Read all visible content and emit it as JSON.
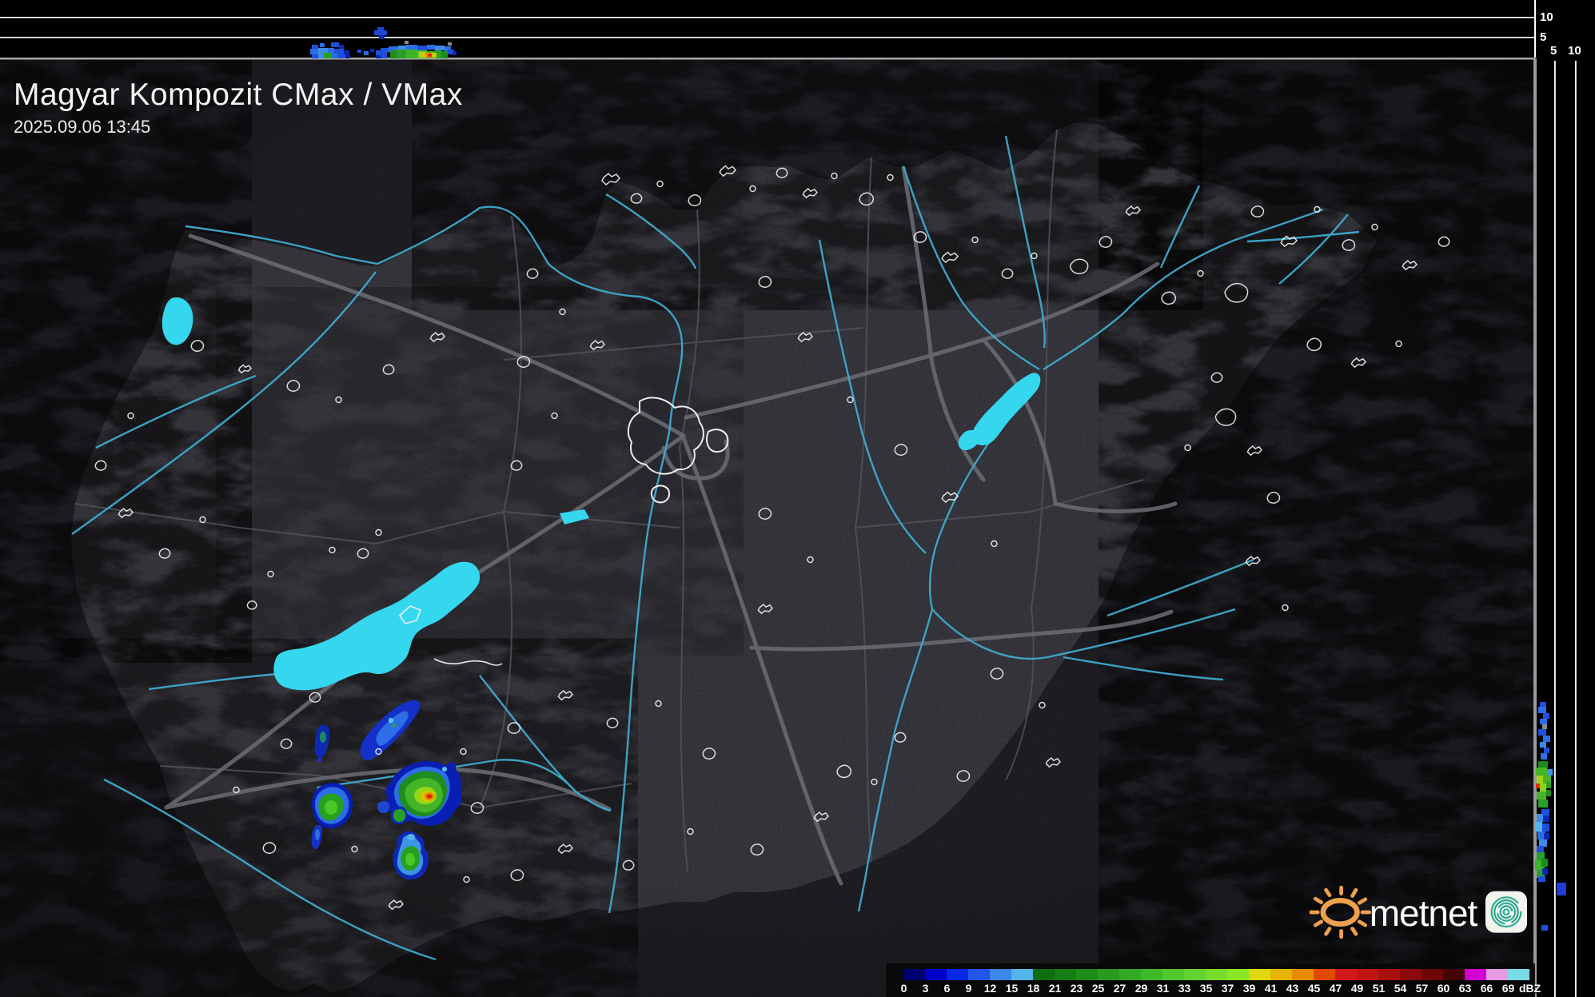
{
  "header": {
    "title": "Magyar Kompozit CMax / VMax",
    "timestamp": "2025.09.06 13:45"
  },
  "top_profile": {
    "ticks": [
      {
        "label": "10"
      },
      {
        "label": "5"
      }
    ]
  },
  "right_profile": {
    "ticks": [
      {
        "label": "5"
      },
      {
        "label": "10"
      }
    ]
  },
  "legend": {
    "labels": [
      "0",
      "3",
      "6",
      "9",
      "12",
      "15",
      "18",
      "21",
      "23",
      "25",
      "27",
      "29",
      "31",
      "33",
      "35",
      "37",
      "39",
      "41",
      "43",
      "45",
      "47",
      "49",
      "51",
      "54",
      "57",
      "60",
      "63",
      "66",
      "69",
      "dBZ"
    ],
    "colors": [
      "#000070",
      "#0000c8",
      "#0a28e6",
      "#2356e8",
      "#3c87e8",
      "#55b4ea",
      "#0f6e0f",
      "#147d14",
      "#1e8c19",
      "#289b1e",
      "#32aa23",
      "#3cb928",
      "#50c82d",
      "#64d232",
      "#78dc2d",
      "#8ce628",
      "#e0d80a",
      "#e6b400",
      "#e68c00",
      "#e04800",
      "#d21919",
      "#c31414",
      "#a80f0f",
      "#8c0a0a",
      "#6e0606",
      "#440303",
      "#d200d2",
      "#e69be1",
      "#78dce6"
    ]
  },
  "logo": {
    "text": "metnet"
  }
}
